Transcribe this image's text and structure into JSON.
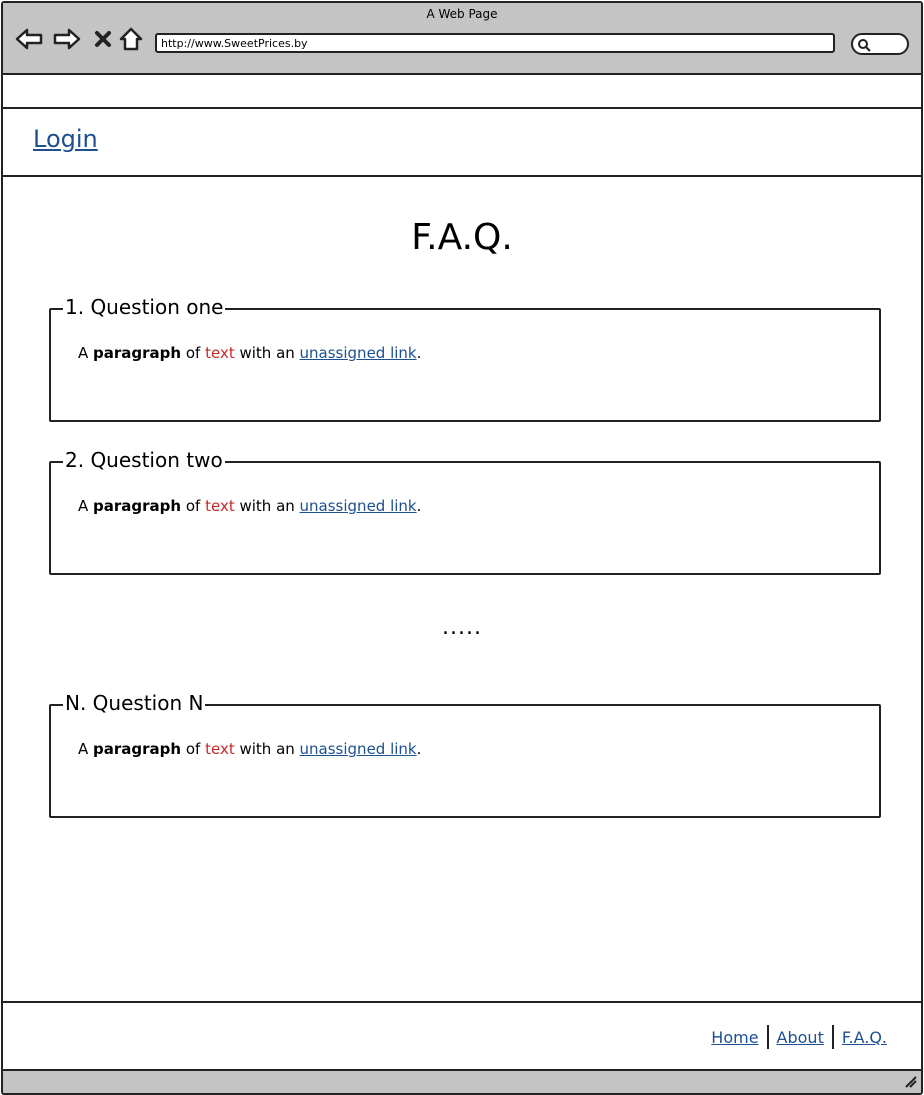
{
  "window": {
    "title": "A Web Page"
  },
  "toolbar": {
    "url": "http://www.SweetPrices.by",
    "icons": [
      "back-arrow-icon",
      "forward-arrow-icon",
      "close-icon",
      "home-icon",
      "search-icon"
    ]
  },
  "header": {
    "login_label": "Login"
  },
  "main": {
    "title": "F.A.Q.",
    "ellipsis": ".....",
    "questions": [
      {
        "legend": "1. Question one",
        "para": {
          "a": "A ",
          "bold": "paragraph",
          "of": " of ",
          "red": "text",
          "with": " with an ",
          "link": "unassigned link",
          "end": "."
        }
      },
      {
        "legend": "2. Question two",
        "para": {
          "a": "A ",
          "bold": "paragraph",
          "of": " of ",
          "red": "text",
          "with": " with an ",
          "link": "unassigned link",
          "end": "."
        }
      },
      {
        "legend": "N. Question N",
        "para": {
          "a": "A ",
          "bold": "paragraph",
          "of": " of ",
          "red": "text",
          "with": " with an ",
          "link": "unassigned link",
          "end": "."
        }
      }
    ]
  },
  "footer": {
    "links": [
      "Home",
      "About",
      "F.A.Q."
    ]
  },
  "colors": {
    "link": "#1d4f91",
    "highlight": "#c72a2a",
    "chrome": "#c4c4c4"
  }
}
